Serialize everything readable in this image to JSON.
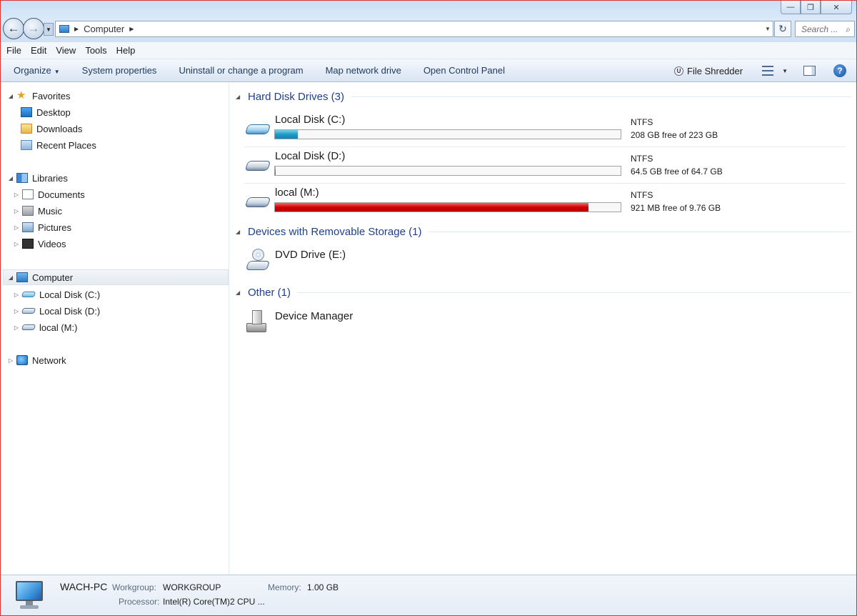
{
  "window": {
    "min_glyph": "—",
    "max_glyph": "❐",
    "close_glyph": "✕"
  },
  "address": {
    "back_glyph": "←",
    "forward_glyph": "→",
    "crumb": "Computer",
    "search_placeholder": "Search ...",
    "refresh_glyph": "↻",
    "search_glyph": "⌕"
  },
  "menu": {
    "items": [
      "File",
      "Edit",
      "View",
      "Tools",
      "Help"
    ]
  },
  "toolbar": {
    "organize": "Organize",
    "system_properties": "System properties",
    "uninstall": "Uninstall or change a program",
    "map_drive": "Map network drive",
    "control_panel": "Open Control Panel",
    "file_shredder": "File Shredder",
    "shredder_glyph": "U",
    "help_glyph": "?"
  },
  "nav": {
    "favorites": "Favorites",
    "favorites_items": [
      "Desktop",
      "Downloads",
      "Recent Places"
    ],
    "libraries": "Libraries",
    "libraries_items": [
      "Documents",
      "Music",
      "Pictures",
      "Videos"
    ],
    "computer": "Computer",
    "computer_items": [
      "Local Disk (C:)",
      "Local Disk (D:)",
      "local (M:)"
    ],
    "network": "Network"
  },
  "content": {
    "hard_disk_header": "Hard Disk Drives (3)",
    "drives": [
      {
        "name": "Local Disk (C:)",
        "fs": "NTFS",
        "free_text": "208 GB free of 223 GB",
        "used_fraction": 0.067,
        "bar_color": "#1f9bc7"
      },
      {
        "name": "Local Disk (D:)",
        "fs": "NTFS",
        "free_text": "64.5 GB free of 64.7 GB",
        "used_fraction": 0.003,
        "bar_color": "#1f9bc7"
      },
      {
        "name": "local (M:)",
        "fs": "NTFS",
        "free_text": "921 MB free of 9.76 GB",
        "used_fraction": 0.908,
        "bar_color": "#d10000"
      }
    ],
    "removable_header": "Devices with Removable Storage (1)",
    "dvd_name": "DVD Drive (E:)",
    "other_header": "Other (1)",
    "device_manager": "Device Manager"
  },
  "details": {
    "pc_name": "WACH-PC",
    "workgroup_label": "Workgroup:",
    "workgroup_value": "WORKGROUP",
    "memory_label": "Memory:",
    "memory_value": "1.00 GB",
    "processor_label": "Processor:",
    "processor_value": "Intel(R) Core(TM)2 CPU ..."
  }
}
